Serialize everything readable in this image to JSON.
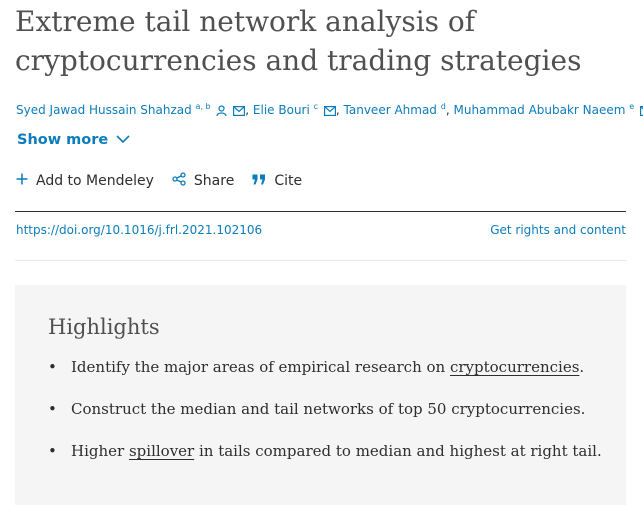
{
  "article": {
    "title": "Extreme tail network analysis of cryptocurrencies and trading strategies"
  },
  "authors": [
    {
      "name": "Syed Jawad Hussain Shahzad",
      "sup": "a, b"
    },
    {
      "name": "Elie Bouri",
      "sup": "c"
    },
    {
      "name": "Tanveer Ahmad",
      "sup": "d"
    },
    {
      "name": "Muhammad Abubakr Naeem",
      "sup": "e"
    }
  ],
  "show_more": "Show more",
  "actions": {
    "mendeley": "Add to Mendeley",
    "share": "Share",
    "cite": "Cite"
  },
  "links": {
    "doi": "https://doi.org/10.1016/j.frl.2021.102106",
    "rights": "Get rights and content"
  },
  "highlights": {
    "title": "Highlights",
    "items": [
      {
        "pre": "Identify the major areas of empirical research on ",
        "link": "cryptocurrencies",
        "post": "."
      },
      {
        "pre": "Construct the median and tail networks of top 50 cryptocurrencies.",
        "link": "",
        "post": ""
      },
      {
        "pre": "Higher ",
        "link": "spillover",
        "post": " in tails compared to median and highest at right tail."
      }
    ]
  },
  "colors": {
    "link": "#0c7dbb",
    "title": "#505050",
    "highlights_bg": "#f5f5f5"
  },
  "icons": [
    "person-icon",
    "mail-icon",
    "chevron-down-icon",
    "plus-icon",
    "share-icon",
    "quote-icon"
  ]
}
